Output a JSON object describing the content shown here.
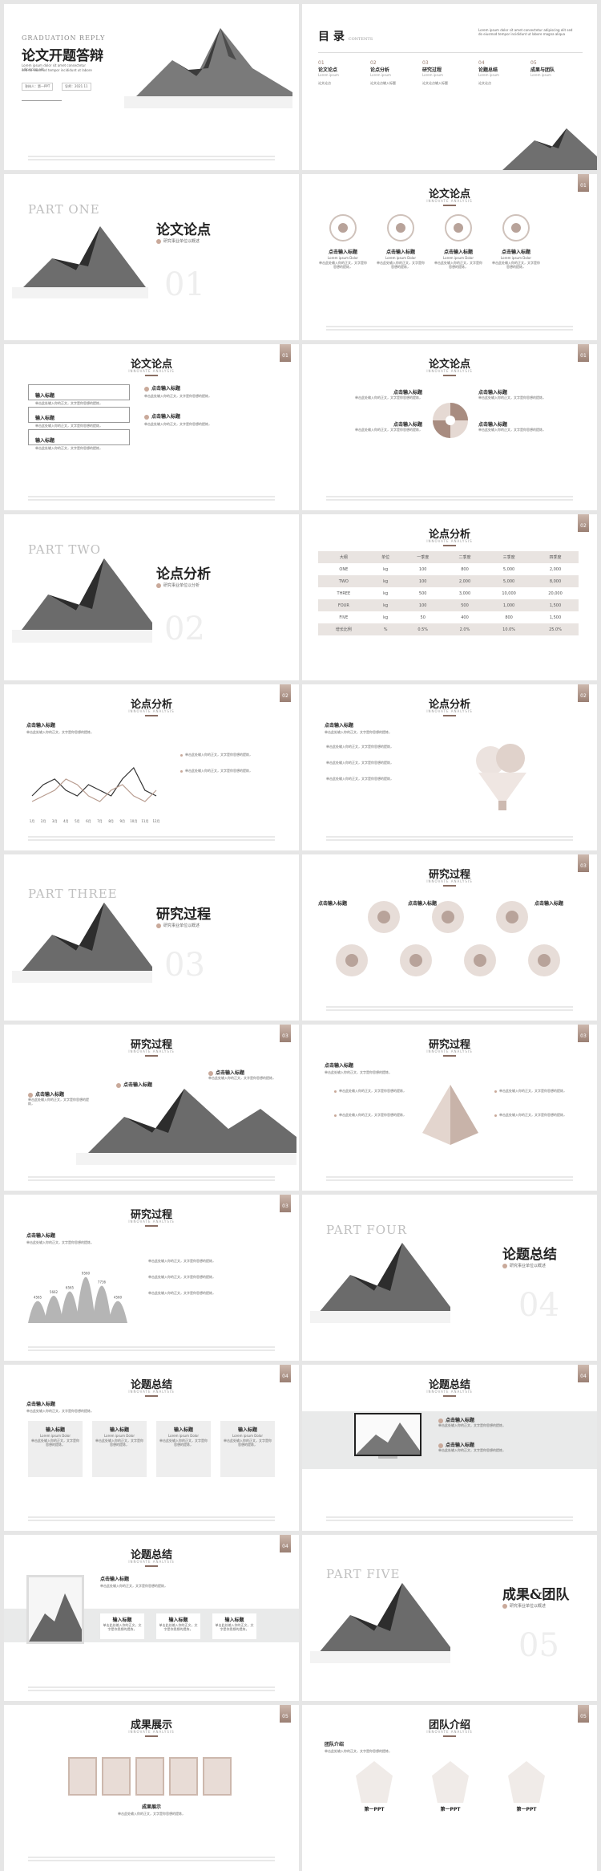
{
  "cover": {
    "eyebrow": "GRADUATION REPLY",
    "title": "论文开题答辩",
    "lines": [
      "Lorem ipsum dolor sit amet consectetur adipiscing elit",
      "sed do eiusmod tempor incididunt ut labore"
    ],
    "field1": "答辩人：第一PPT",
    "field2": "导师：2021.11"
  },
  "toc": {
    "title": "目 录",
    "title_en": "CONTENTS",
    "desc": "Lorem ipsum dolor sit amet consectetur adipiscing elit sed do eiusmod tempor incididunt ut labore magna aliqua",
    "items": [
      {
        "num": "01",
        "label": "论文论点",
        "en": "Lorem ipsum",
        "desc": "论文论点"
      },
      {
        "num": "02",
        "label": "论点分析",
        "en": "Lorem ipsum",
        "desc": "论文论点输入标题"
      },
      {
        "num": "03",
        "label": "研究过程",
        "en": "Lorem ipsum",
        "desc": "论文论点输入标题"
      },
      {
        "num": "04",
        "label": "论题总结",
        "en": "Lorem ipsum",
        "desc": "论文论点"
      },
      {
        "num": "05",
        "label": "成果与团队",
        "en": "Lorem ipsum",
        "desc": ""
      }
    ]
  },
  "parts": [
    {
      "part": "PART ONE",
      "title": "论文论点",
      "sub": "研究事业单位以概述",
      "num": "01"
    },
    {
      "part": "PART TWO",
      "title": "论点分析",
      "sub": "研究事业单位以分析",
      "num": "02"
    },
    {
      "part": "PART THREE",
      "title": "研究过程",
      "sub": "研究事业单位以概述",
      "num": "03"
    },
    {
      "part": "PART FOUR",
      "title": "论题总结",
      "sub": "研究事业单位以概述",
      "num": "04"
    },
    {
      "part": "PART FIVE",
      "title": "成果&团队",
      "sub": "研究事业单位以概述",
      "num": "05"
    }
  ],
  "common": {
    "heading": "点击输入标题",
    "heading_en": "Lorem ipsum Dolor",
    "body": "单击此处输入你的正文，文字是你思想的提炼，",
    "body2": "请尽量言简意赅的阐述观点。",
    "input": "输入标题",
    "subtitle": "INNOVATE ANALYSIS"
  },
  "slides": {
    "s04": {
      "title": "论文论点",
      "badge": "01"
    },
    "s05": {
      "title": "论文论点",
      "badge": "01"
    },
    "s06": {
      "title": "论文论点",
      "badge": "01"
    },
    "s08": {
      "title": "论点分析",
      "badge": "02"
    },
    "s09": {
      "title": "论点分析",
      "badge": "02"
    },
    "s10": {
      "title": "论点分析",
      "badge": "02"
    },
    "s12": {
      "title": "研究过程",
      "badge": "03"
    },
    "s13": {
      "title": "研究过程",
      "badge": "03"
    },
    "s14": {
      "title": "研究过程",
      "badge": "03"
    },
    "s15": {
      "title": "研究过程",
      "badge": "03"
    },
    "s17": {
      "title": "论题总结",
      "badge": "04"
    },
    "s18": {
      "title": "论题总结",
      "badge": "04"
    },
    "s19": {
      "title": "论题总结",
      "badge": "04"
    },
    "s21": {
      "title": "成果展示",
      "badge": "05",
      "caption": "成果展示"
    },
    "s22": {
      "title": "团队介绍",
      "badge": "05",
      "team_label": "团队介绍",
      "members": [
        "第一PPT",
        "第一PPT",
        "第一PPT"
      ]
    }
  },
  "table": {
    "header": [
      "大纲",
      "单位",
      "一季度",
      "二季度",
      "三季度",
      "四季度"
    ],
    "rows": [
      [
        "ONE",
        "kg",
        "100",
        "800",
        "5,000",
        "2,000"
      ],
      [
        "TWO",
        "kg",
        "100",
        "2,000",
        "5,000",
        "8,000"
      ],
      [
        "THREE",
        "kg",
        "500",
        "3,000",
        "10,000",
        "20,000"
      ],
      [
        "FOUR",
        "kg",
        "100",
        "500",
        "1,000",
        "1,500"
      ],
      [
        "FIVE",
        "kg",
        "50",
        "400",
        "800",
        "1,500"
      ],
      [
        "增长比例",
        "%",
        "0.5%",
        "2.0%",
        "10.0%",
        "25.0%"
      ]
    ]
  },
  "line_chart": {
    "type": "line",
    "categories": [
      "1月",
      "2月",
      "3月",
      "4月",
      "5月",
      "6月",
      "7月",
      "8月",
      "9月",
      "10月",
      "11月",
      "12月"
    ],
    "series": [
      {
        "values": [
          3,
          5,
          6,
          4,
          3,
          5,
          4,
          3,
          6,
          8,
          4,
          3
        ]
      },
      {
        "values": [
          2,
          3,
          4,
          6,
          5,
          3,
          2,
          4,
          5,
          3,
          2,
          4
        ]
      }
    ]
  },
  "mountain_chart": {
    "labels": [
      "4565",
      "5662",
      "6565",
      "9560",
      "7736",
      "4560"
    ],
    "values": [
      4565,
      5662,
      6565,
      9560,
      7736,
      4560
    ]
  },
  "colors": {
    "accent": "#9a7f73",
    "light": "#e9e4e1"
  }
}
